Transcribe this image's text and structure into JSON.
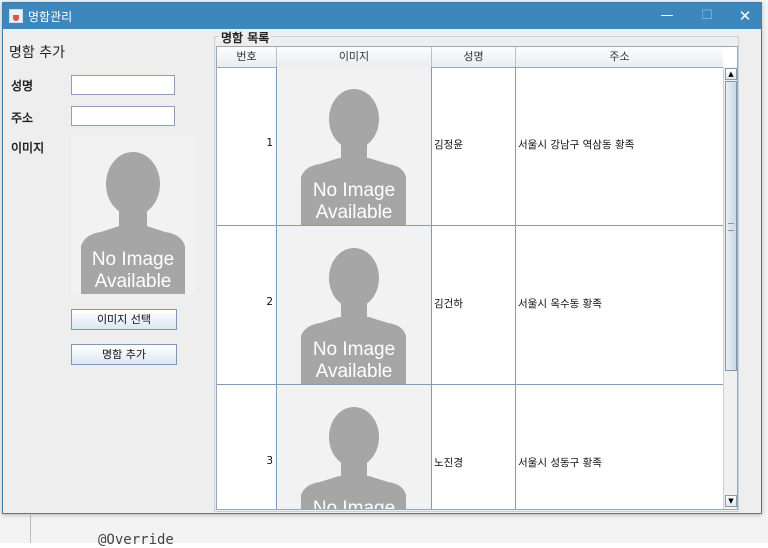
{
  "window": {
    "title": "명함관리"
  },
  "titlebar_buttons": {
    "minimize": "—",
    "maximize": "☐",
    "close": "✕"
  },
  "add_panel": {
    "heading": "명함 추가",
    "name_label": "성명",
    "name_value": "",
    "address_label": "주소",
    "address_value": "",
    "image_label": "이미지",
    "select_image_button": "이미지 선택",
    "add_button": "명함 추가"
  },
  "no_image": {
    "line1": "No Image",
    "line2": "Available"
  },
  "list_panel": {
    "heading": "명함 목록",
    "columns": [
      "번호",
      "이미지",
      "성명",
      "주소"
    ],
    "rows": [
      {
        "num": "1",
        "name": "김정윤",
        "address": "서울시 강남구 역삼동 황족"
      },
      {
        "num": "2",
        "name": "김건하",
        "address": "서울시 옥수동 황족"
      },
      {
        "num": "3",
        "name": "노진경",
        "address": "서울시 성동구 황족"
      }
    ]
  },
  "background": {
    "code_text": "@Override"
  },
  "colors": {
    "titlebar": "#3c88bd",
    "silhouette": "#a6a6a6",
    "placeholder_bg": "#f2f2f2"
  }
}
